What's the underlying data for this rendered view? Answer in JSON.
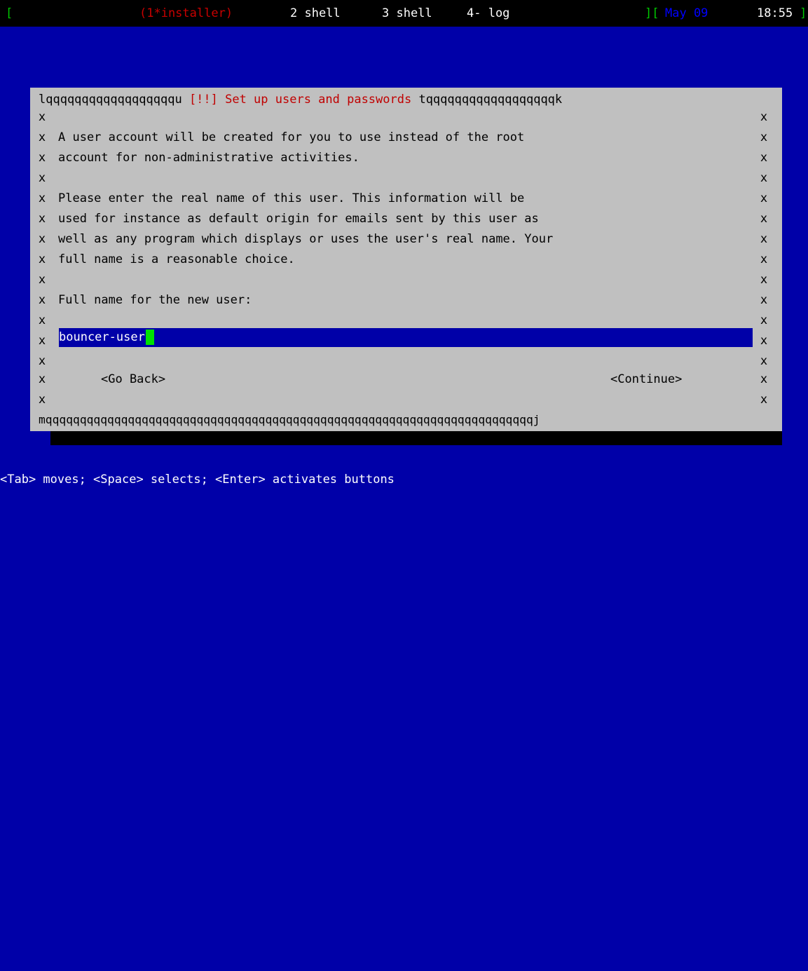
{
  "statusbar": {
    "open_bracket": "[",
    "tab1": "(1*installer)",
    "tab2": "2 shell",
    "tab3": "3 shell",
    "tab4": "4- log",
    "sep": "][",
    "date": "May 09",
    "time": "18:55",
    "close_bracket": "]"
  },
  "dialog": {
    "title_left": "lqqqqqqqqqqqqqqqqqqu ",
    "title": "[!!] Set up users and passwords",
    "title_right": " tqqqqqqqqqqqqqqqqqqk",
    "border_char": "x",
    "para1_line1": "A user account will be created for you to use instead of the root",
    "para1_line2": "account for non-administrative activities.",
    "para2_line1": "Please enter the real name of this user. This information will be",
    "para2_line2": "used for instance as default origin for emails sent by this user as",
    "para2_line3": "well as any program which displays or uses the user's real name. Your",
    "para2_line4": "full name is a reasonable choice.",
    "prompt": "Full name for the new user:",
    "input_value": "bouncer-user",
    "go_back": "<Go Back>",
    "continue": "<Continue>",
    "bottom_border": "mqqqqqqqqqqqqqqqqqqqqqqqqqqqqqqqqqqqqqqqqqqqqqqqqqqqqqqqqqqqqqqqqqqqqqqqj"
  },
  "helpbar": {
    "text": "<Tab> moves; <Space> selects; <Enter> activates buttons"
  },
  "colors": {
    "background": "#0000a8",
    "dialog": "#c0c0c0",
    "title": "#c00000",
    "cursor": "#00e000"
  }
}
